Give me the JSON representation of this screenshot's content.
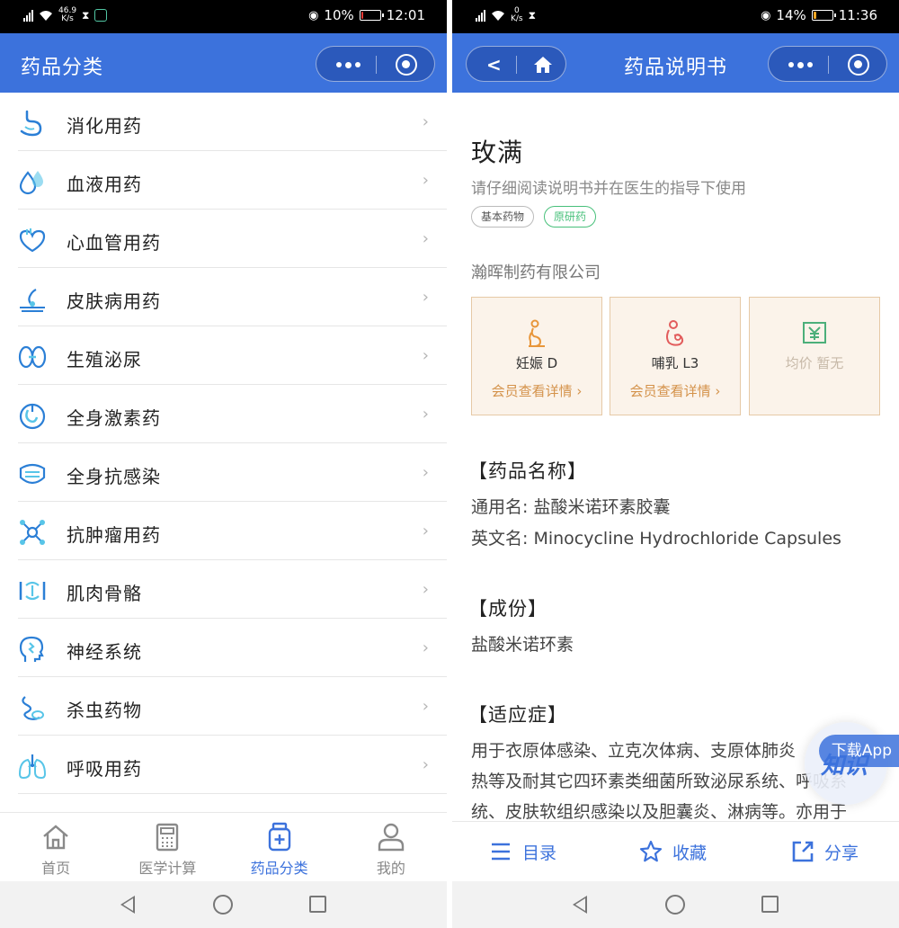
{
  "left": {
    "status": {
      "net": "46.9",
      "net_unit": "K/s",
      "battery": "10%",
      "time": "12:01",
      "battery_level": 0.1,
      "battery_color": "#e53935"
    },
    "header": {
      "title": "药品分类"
    },
    "categories": [
      {
        "label": "消化用药",
        "icon": "stomach-icon"
      },
      {
        "label": "血液用药",
        "icon": "blood-drop-icon"
      },
      {
        "label": "心血管用药",
        "icon": "heart-icon"
      },
      {
        "label": "皮肤病用药",
        "icon": "skin-icon"
      },
      {
        "label": "生殖泌尿",
        "icon": "kidney-icon"
      },
      {
        "label": "全身激素药",
        "icon": "hormone-icon"
      },
      {
        "label": "全身抗感染",
        "icon": "mask-icon"
      },
      {
        "label": "抗肿瘤用药",
        "icon": "molecule-icon"
      },
      {
        "label": "肌肉骨骼",
        "icon": "bone-icon"
      },
      {
        "label": "神经系统",
        "icon": "brain-icon"
      },
      {
        "label": "杀虫药物",
        "icon": "worm-icon"
      },
      {
        "label": "呼吸用药",
        "icon": "lung-icon"
      }
    ],
    "tabs": [
      {
        "label": "首页",
        "icon": "home-icon"
      },
      {
        "label": "医学计算",
        "icon": "calculator-icon"
      },
      {
        "label": "药品分类",
        "icon": "medicine-bottle-icon",
        "active": true
      },
      {
        "label": "我的",
        "icon": "user-icon"
      }
    ]
  },
  "right": {
    "status": {
      "net": "0",
      "net_unit": "K/s",
      "battery": "14%",
      "time": "11:36",
      "battery_level": 0.14,
      "battery_color": "#f5a623"
    },
    "header": {
      "title": "药品说明书"
    },
    "drug": {
      "name": "玫满",
      "hint": "请仔细阅读说明书并在医生的指导下使用",
      "tags": [
        "基本药物",
        "原研药"
      ],
      "manufacturer": "瀚晖制药有限公司"
    },
    "cards": [
      {
        "title": "妊娠 D",
        "link": "会员查看详情 ›",
        "icon": "pregnancy-icon"
      },
      {
        "title": "哺乳 L3",
        "link": "会员查看详情 ›",
        "icon": "breastfeeding-icon"
      },
      {
        "title": "均价 暂无",
        "icon": "price-icon"
      }
    ],
    "sections": {
      "name_heading": "【药品名称】",
      "generic_name": "通用名: 盐酸米诺环素胶囊",
      "english_name": "英文名: Minocycline Hydrochloride Capsules",
      "component_heading": "【成份】",
      "component": "盐酸米诺环素",
      "indication_heading": "【适应症】",
      "indication_lines": [
        "用于衣原体感染、立克次体病、支原体肺炎",
        "热等及耐其它四环素类细菌所致泌尿系统、呼吸系",
        "统、皮肤软组织感染以及胆囊炎、淋病等。亦用于"
      ]
    },
    "float": {
      "logo": "知识",
      "ribbon": "下载App"
    },
    "actions": [
      {
        "label": "目录",
        "icon": "list-icon"
      },
      {
        "label": "收藏",
        "icon": "star-icon"
      },
      {
        "label": "分享",
        "icon": "share-icon"
      }
    ]
  },
  "colors": {
    "primary": "#3c72dc",
    "accent_gold": "#d4924a",
    "card_bg": "#fbf3ea",
    "tag_green": "#47c07a"
  }
}
